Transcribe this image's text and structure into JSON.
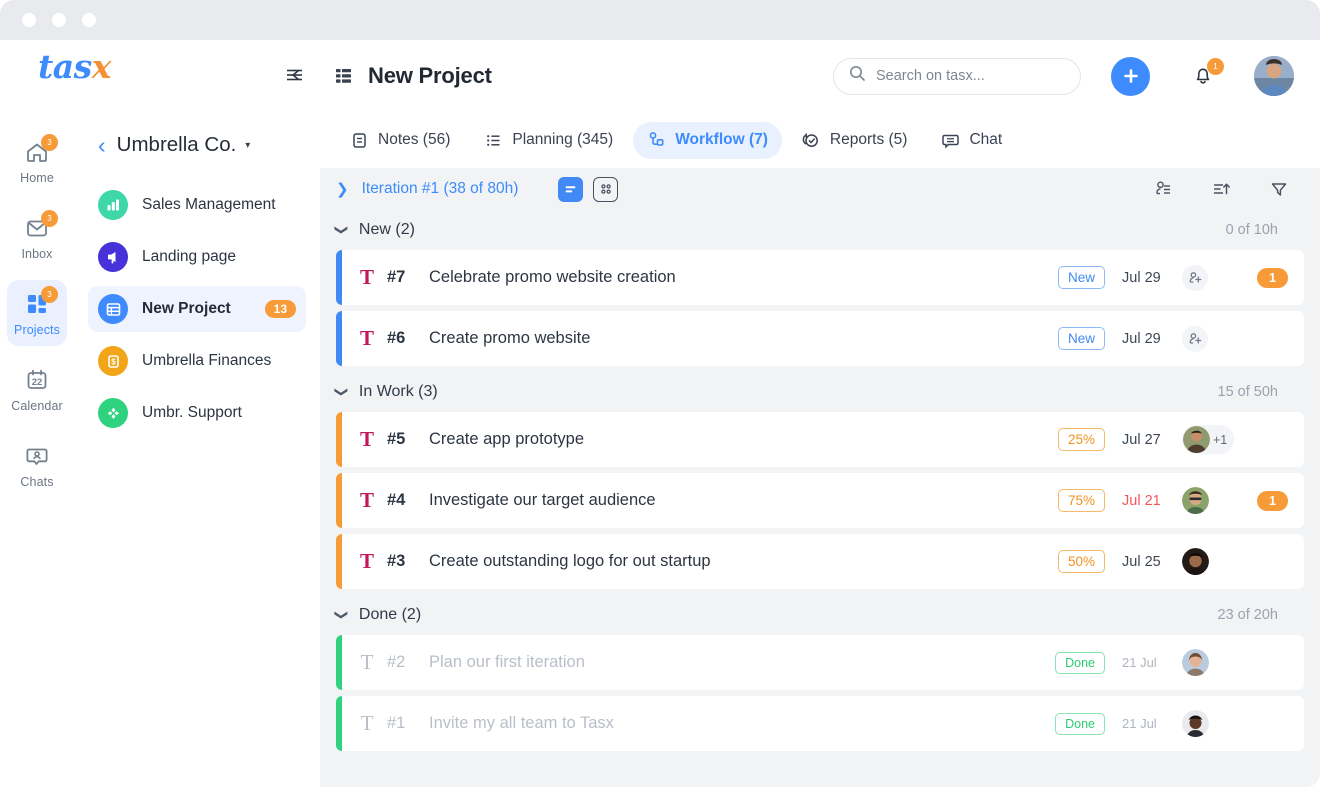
{
  "brand": {
    "name_part1": "tas",
    "name_part2": "x",
    "accent": "#3d8bfd",
    "accent_orange": "#f59033"
  },
  "rail": {
    "items": [
      {
        "label": "Home",
        "icon": "home-icon",
        "badge": "3",
        "active": false
      },
      {
        "label": "Inbox",
        "icon": "envelope-icon",
        "badge": "3",
        "active": false
      },
      {
        "label": "Projects",
        "icon": "grid-icon",
        "badge": "3",
        "active": true
      },
      {
        "label": "Calendar",
        "icon": "calendar-icon",
        "badge": "",
        "active": false,
        "day": "22"
      },
      {
        "label": "Chats",
        "icon": "chat-person-icon",
        "badge": "",
        "active": false
      }
    ]
  },
  "sidebar": {
    "collapse_icon": "collapse-sidebar-icon",
    "org": {
      "back_icon": "chevron-left-icon",
      "name": "Umbrella Co.",
      "caret_icon": "chevron-down-icon"
    },
    "projects": [
      {
        "name": "Sales Management",
        "icon": "bar-chart-icon",
        "color": "#3ed8a8",
        "badge": "",
        "active": false
      },
      {
        "name": "Landing page",
        "icon": "megaphone-icon",
        "color": "#4632d8",
        "badge": "",
        "active": false
      },
      {
        "name": "New Project",
        "icon": "table-icon",
        "color": "#3d8bfd",
        "badge": "13",
        "active": true
      },
      {
        "name": "Umbrella Finances",
        "icon": "money-icon",
        "color": "#f3a51a",
        "badge": "",
        "active": false
      },
      {
        "name": "Umbr. Support",
        "icon": "support-icon",
        "color": "#2ed27f",
        "badge": "",
        "active": false
      }
    ]
  },
  "header": {
    "title_icon": "list-grid-icon",
    "title": "New Project",
    "search": {
      "icon": "search-icon",
      "placeholder": "Search on tasx...",
      "value": ""
    },
    "add_button": {
      "icon": "plus-icon",
      "label": ""
    },
    "notifications": {
      "icon": "bell-icon",
      "badge": "1"
    },
    "avatar": {
      "name": "avatar"
    }
  },
  "tabs": [
    {
      "label": "Notes (56)",
      "icon": "note-icon",
      "active": false
    },
    {
      "label": "Planning (345)",
      "icon": "list-checklist-icon",
      "active": false
    },
    {
      "label": "Workflow (7)",
      "icon": "workflow-icon",
      "active": true
    },
    {
      "label": "Reports (5)",
      "icon": "report-check-icon",
      "active": false
    },
    {
      "label": "Chat",
      "icon": "chat-bubble-icon",
      "active": false
    }
  ],
  "iteration": {
    "caret_icon": "chevron-right-icon",
    "label": "Iteration #1 (38 of 80h)",
    "views": [
      {
        "name": "list-view-toggle",
        "active": true
      },
      {
        "name": "board-view-toggle",
        "active": false
      }
    ],
    "tools": [
      {
        "name": "assignee-filter-icon"
      },
      {
        "name": "sort-ascending-icon"
      },
      {
        "name": "filter-funnel-icon"
      }
    ]
  },
  "groups": [
    {
      "title": "New (2)",
      "hours": "0 of 10h",
      "accent": "#4189f4",
      "tasks": [
        {
          "type_icon": "T",
          "number": "#7",
          "title": "Celebrate promo website creation",
          "status": {
            "label": "New",
            "kind": "new"
          },
          "date": "Jul 29",
          "overdue": false,
          "assignees": [],
          "add_person": true,
          "count": "1",
          "done": false
        },
        {
          "type_icon": "T",
          "number": "#6",
          "title": "Create promo website",
          "status": {
            "label": "New",
            "kind": "new"
          },
          "date": "Jul 29",
          "overdue": false,
          "assignees": [],
          "add_person": true,
          "count": "",
          "done": false
        }
      ]
    },
    {
      "title": "In Work (3)",
      "hours": "15 of 50h",
      "accent": "#f79a38",
      "tasks": [
        {
          "type_icon": "T",
          "number": "#5",
          "title": "Create app prototype",
          "status": {
            "label": "25%",
            "kind": "pct"
          },
          "date": "Jul 27",
          "overdue": false,
          "assignees": [
            "#b4785a"
          ],
          "extra": "+1",
          "add_person": false,
          "count": "",
          "done": false
        },
        {
          "type_icon": "T",
          "number": "#4",
          "title": "Investigate our target audience",
          "status": {
            "label": "75%",
            "kind": "pct"
          },
          "date": "Jul 21",
          "overdue": true,
          "assignees": [
            "#7e8a5c"
          ],
          "add_person": false,
          "count": "1",
          "done": false
        },
        {
          "type_icon": "T",
          "number": "#3",
          "title": "Create outstanding logo for out startup",
          "status": {
            "label": "50%",
            "kind": "pct"
          },
          "date": "Jul 25",
          "overdue": false,
          "assignees": [
            "#3a2a24"
          ],
          "add_person": false,
          "count": "",
          "done": false
        }
      ]
    },
    {
      "title": "Done (2)",
      "hours": "23 of 20h",
      "accent": "#2ed27f",
      "tasks": [
        {
          "type_icon": "T",
          "number": "#2",
          "title": "Plan our first iteration",
          "status": {
            "label": "Done",
            "kind": "done"
          },
          "date": "21 Jul",
          "overdue": false,
          "assignees": [
            "#c48f84"
          ],
          "add_person": false,
          "count": "",
          "done": true
        },
        {
          "type_icon": "T",
          "number": "#1",
          "title": "Invite my all team to Tasx",
          "status": {
            "label": "Done",
            "kind": "done"
          },
          "date": "21 Jul",
          "overdue": false,
          "assignees": [
            "#4a3128"
          ],
          "add_person": false,
          "count": "",
          "done": true
        }
      ]
    }
  ]
}
